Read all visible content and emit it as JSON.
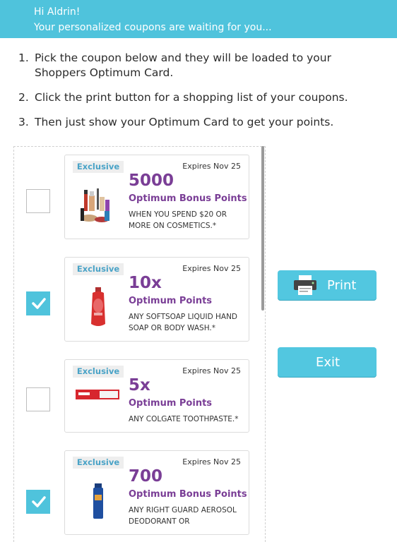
{
  "header": {
    "greeting": "Hi Aldrin!",
    "subtitle": "Your personalized coupons are waiting for you..."
  },
  "instructions": [
    {
      "num": "1.",
      "text": "Pick the coupon below and they will be loaded to your Shoppers Optimum Card."
    },
    {
      "num": "2.",
      "text": "Click the print button for a shopping list of your coupons."
    },
    {
      "num": "3.",
      "text": "Then just show your Optimum Card to get your points."
    }
  ],
  "coupons": [
    {
      "badge": "Exclusive",
      "expires": "Expires Nov 25",
      "value": "5000",
      "type": "Optimum Bonus Points",
      "description": "WHEN YOU SPEND $20 OR MORE ON COSMETICS.*",
      "checked": false,
      "image": "cosmetics-image"
    },
    {
      "badge": "Exclusive",
      "expires": "Expires Nov 25",
      "value": "10x",
      "type": "Optimum Points",
      "description": "ANY SOFTSOAP LIQUID HAND SOAP OR BODY WASH.*",
      "checked": true,
      "image": "softsoap-bottle-image"
    },
    {
      "badge": "Exclusive",
      "expires": "Expires Nov 25",
      "value": "5x",
      "type": "Optimum Points",
      "description": "ANY COLGATE TOOTHPASTE.*",
      "checked": false,
      "image": "colgate-toothpaste-image"
    },
    {
      "badge": "Exclusive",
      "expires": "Expires Nov 25",
      "value": "700",
      "type": "Optimum Bonus Points",
      "description": "ANY RIGHT GUARD AEROSOL DEODORANT OR",
      "checked": true,
      "image": "right-guard-can-image"
    }
  ],
  "actions": {
    "print_label": "Print",
    "exit_label": "Exit"
  },
  "colors": {
    "accent": "#4fc3dc",
    "purple": "#7a3e96",
    "badge_text": "#4aa3c7"
  },
  "icons": {
    "print": "printer-icon",
    "check": "checkmark-icon"
  }
}
